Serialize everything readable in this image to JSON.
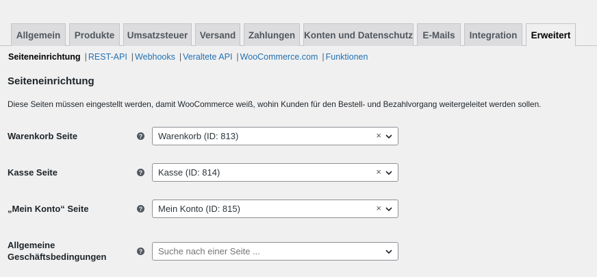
{
  "tabs": [
    {
      "label": "Allgemein"
    },
    {
      "label": "Produkte"
    },
    {
      "label": "Umsatzsteuer"
    },
    {
      "label": "Versand"
    },
    {
      "label": "Zahlungen"
    },
    {
      "label": "Konten und Datenschutz"
    },
    {
      "label": "E-Mails"
    },
    {
      "label": "Integration"
    },
    {
      "label": "Erweitert",
      "active": true
    }
  ],
  "subnav": {
    "current": "Seiteneinrichtung",
    "links": [
      "REST-API",
      "Webhooks",
      "Veraltete API",
      "WooCommerce.com",
      "Funktionen"
    ],
    "separator": "|"
  },
  "section": {
    "title": "Seiteneinrichtung",
    "description": "Diese Seiten müssen eingestellt werden, damit WooCommerce weiß, wohin Kunden für den Bestell- und Bezahlvorgang weitergeleitet werden sollen."
  },
  "rows": [
    {
      "label": "Warenkorb Seite",
      "value": "Warenkorb (ID: 813)",
      "clear": "×",
      "help_icon": "?"
    },
    {
      "label": "Kasse Seite",
      "value": "Kasse (ID: 814)",
      "clear": "×",
      "help_icon": "?"
    },
    {
      "label": "„Mein Konto“ Seite",
      "value": "Mein Konto (ID: 815)",
      "clear": "×",
      "help_icon": "?"
    },
    {
      "label_line1": "Allgemeine",
      "label_line2": "Geschäftsbedingungen",
      "placeholder": "Suche nach einer Seite ...",
      "help_icon": "?"
    }
  ],
  "colors": {
    "link": "#2271b1",
    "background": "#f0f0f1",
    "tab_inactive": "#dcdcde"
  }
}
